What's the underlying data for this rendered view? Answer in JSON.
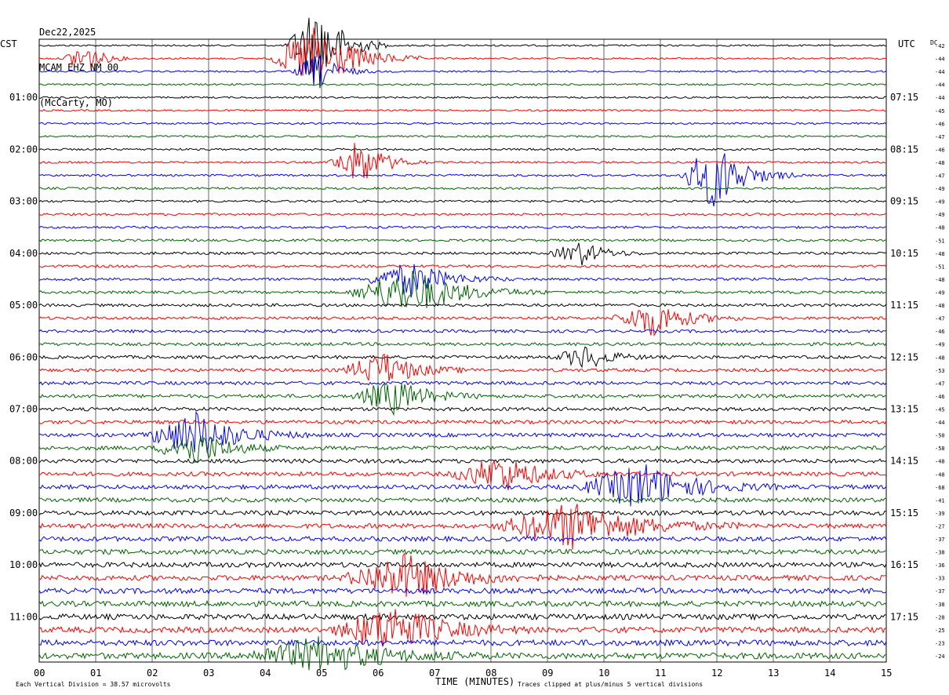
{
  "header": {
    "date": "Dec22,2025",
    "station": "MCAM EHZ NM 00",
    "location": "(McCarty, MO)"
  },
  "left_zone": "CST",
  "right_zone": "UTC",
  "dc_label": "DC",
  "footer": {
    "vertical_division": "Each Vertical Division = 38.57 microvolts",
    "clip_note": "Traces clipped at plus/minus 5 vertical divisions"
  },
  "colors": {
    "line1": "#000000",
    "line2": "#ff0000",
    "line3": "#0000ff",
    "line4": "#006400"
  },
  "chart_data": {
    "type": "line",
    "xlabel": "TIME (MINUTES)",
    "xlim": [
      0,
      15
    ],
    "x_ticks": [
      "00",
      "01",
      "02",
      "03",
      "04",
      "05",
      "06",
      "07",
      "08",
      "09",
      "10",
      "11",
      "12",
      "13",
      "14",
      "15"
    ],
    "rows": 48,
    "row_minutes": 15,
    "trace_colors": [
      "black",
      "red",
      "blue",
      "green"
    ],
    "left_hour_labels": [
      "01:00",
      "02:00",
      "03:00",
      "04:00",
      "05:00",
      "06:00",
      "07:00",
      "08:00",
      "09:00",
      "10:00",
      "11:00"
    ],
    "right_hour_labels": [
      "07:15",
      "08:15",
      "09:15",
      "10:15",
      "11:15",
      "12:15",
      "13:15",
      "14:15",
      "15:15",
      "16:15",
      "17:15"
    ],
    "dc_offsets": [
      -42,
      -44,
      -44,
      -44,
      -44,
      -45,
      -46,
      -47,
      -46,
      -48,
      -47,
      -49,
      -49,
      -49,
      -48,
      -51,
      -48,
      -51,
      -48,
      -49,
      -48,
      -47,
      -46,
      -49,
      -48,
      -53,
      -47,
      -46,
      -45,
      -44,
      -50,
      -58,
      -48,
      -48,
      -68,
      -41,
      -39,
      -27,
      -37,
      -38,
      -36,
      -33,
      -37,
      -38,
      -28,
      -25,
      -23,
      -24
    ],
    "events": [
      {
        "row": 0,
        "minute": 4.95,
        "amp": 8,
        "dur": 0.6,
        "color": "black"
      },
      {
        "row": 1,
        "minute": 4.95,
        "amp": 6,
        "dur": 0.9,
        "color": "red"
      },
      {
        "row": 1,
        "minute": 0.8,
        "amp": 3,
        "dur": 0.4,
        "color": "red"
      },
      {
        "row": 2,
        "minute": 4.95,
        "amp": 3,
        "dur": 0.5,
        "color": "blue"
      },
      {
        "row": 9,
        "minute": 5.7,
        "amp": 4,
        "dur": 0.6,
        "color": "red"
      },
      {
        "row": 10,
        "minute": 12.0,
        "amp": 6,
        "dur": 0.7,
        "color": "blue"
      },
      {
        "row": 16,
        "minute": 9.6,
        "amp": 2,
        "dur": 0.6,
        "color": "black"
      },
      {
        "row": 18,
        "minute": 6.6,
        "amp": 3,
        "dur": 0.9,
        "color": "blue"
      },
      {
        "row": 19,
        "minute": 6.6,
        "amp": 4,
        "dur": 1.2,
        "color": "green"
      },
      {
        "row": 21,
        "minute": 10.9,
        "amp": 3,
        "dur": 0.8,
        "color": "red"
      },
      {
        "row": 24,
        "minute": 9.7,
        "amp": 2,
        "dur": 0.6,
        "color": "black"
      },
      {
        "row": 25,
        "minute": 6.1,
        "amp": 3,
        "dur": 0.8,
        "color": "red"
      },
      {
        "row": 27,
        "minute": 6.3,
        "amp": 3,
        "dur": 0.8,
        "color": "green"
      },
      {
        "row": 30,
        "minute": 2.8,
        "amp": 4,
        "dur": 1.0,
        "color": "blue"
      },
      {
        "row": 31,
        "minute": 2.8,
        "amp": 3,
        "dur": 0.8,
        "color": "green"
      },
      {
        "row": 33,
        "minute": 8.2,
        "amp": 3,
        "dur": 1.0,
        "color": "red"
      },
      {
        "row": 34,
        "minute": 10.7,
        "amp": 4,
        "dur": 1.2,
        "color": "blue"
      },
      {
        "row": 37,
        "minute": 9.5,
        "amp": 4,
        "dur": 1.5,
        "color": "red"
      },
      {
        "row": 41,
        "minute": 6.5,
        "amp": 4,
        "dur": 1.2,
        "color": "red"
      },
      {
        "row": 45,
        "minute": 6.3,
        "amp": 4,
        "dur": 1.2,
        "color": "red"
      },
      {
        "row": 47,
        "minute": 5.0,
        "amp": 3,
        "dur": 1.5,
        "color": "green"
      }
    ]
  }
}
